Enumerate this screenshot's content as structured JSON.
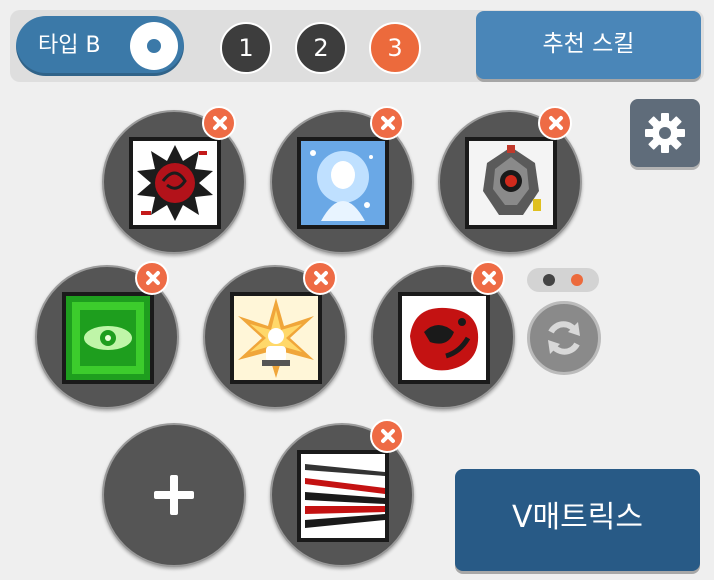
{
  "header": {
    "type_toggle_label": "타입 B",
    "pages": [
      {
        "label": "1",
        "active": false
      },
      {
        "label": "2",
        "active": false
      },
      {
        "label": "3",
        "active": true
      }
    ],
    "recommend_label": "추천 스킬"
  },
  "skills": [
    {
      "name": "dark-red-sigil-skill-icon"
    },
    {
      "name": "blue-spirit-skill-icon"
    },
    {
      "name": "gray-mech-eye-skill-icon"
    },
    {
      "name": "green-eye-skill-icon"
    },
    {
      "name": "golden-radiance-skill-icon"
    },
    {
      "name": "red-dragon-skill-icon"
    },
    {
      "name": "red-black-blades-skill-icon"
    }
  ],
  "pager": {
    "count": 2,
    "active_index": 1
  },
  "matrix_label": "V매트릭스",
  "colors": {
    "accent_blue": "#4a86b8",
    "toggle_blue": "#3b79a8",
    "active_orange": "#ec6a3c",
    "remove_red": "#ee6b45",
    "matrix_navy": "#285a86"
  }
}
